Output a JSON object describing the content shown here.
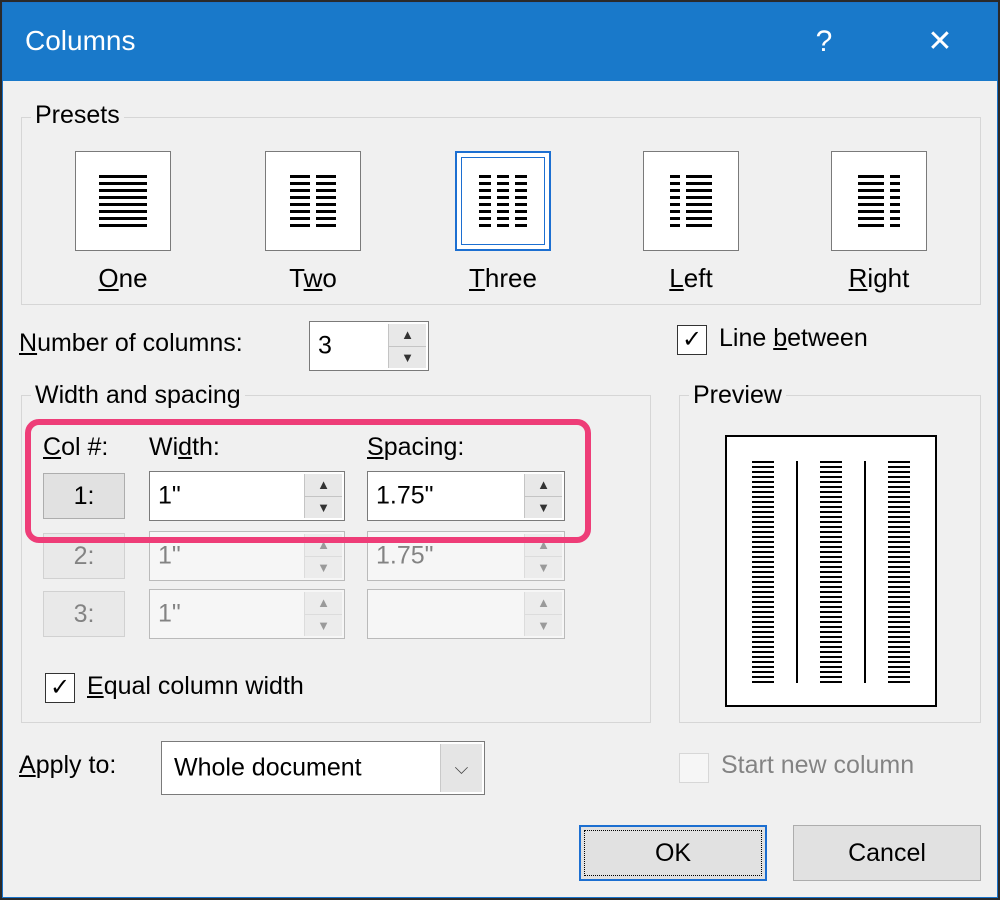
{
  "window": {
    "title": "Columns",
    "help_label": "?",
    "close_label": "✕"
  },
  "presets": {
    "group_label": "Presets",
    "items": [
      {
        "label": "One",
        "accel": "O",
        "rest": "ne"
      },
      {
        "label": "Two",
        "accel": "w",
        "before": "T",
        "rest": "o"
      },
      {
        "label": "Three",
        "accel": "T",
        "rest": "hree",
        "selected": true
      },
      {
        "label": "Left",
        "accel": "L",
        "rest": "eft"
      },
      {
        "label": "Right",
        "accel": "R",
        "rest": "ight"
      }
    ]
  },
  "number_of_columns": {
    "label_accel": "N",
    "label_rest": "umber of columns:",
    "value": "3"
  },
  "line_between": {
    "before": "Line ",
    "accel": "b",
    "rest": "etween",
    "checked": true,
    "check_glyph": "✓"
  },
  "width_spacing": {
    "group_label": "Width and spacing",
    "col_header_accel": "C",
    "col_header_rest": "ol #:",
    "width_header_before": "Wi",
    "width_header_accel": "d",
    "width_header_rest": "th:",
    "spacing_header_accel": "S",
    "spacing_header_rest": "pacing:",
    "rows": [
      {
        "col": "1:",
        "width": "1\"",
        "spacing": "1.75\"",
        "enabled": true
      },
      {
        "col": "2:",
        "width": "1\"",
        "spacing": "1.75\"",
        "enabled": false
      },
      {
        "col": "3:",
        "width": "1\"",
        "spacing": "",
        "enabled": false
      }
    ],
    "spin_up": "▲",
    "spin_down": "▼"
  },
  "equal_width": {
    "accel": "E",
    "rest": "qual column width",
    "checked": true,
    "check_glyph": "✓"
  },
  "preview": {
    "group_label": "Preview"
  },
  "apply_to": {
    "label_accel": "A",
    "label_rest": "pply to:",
    "value": "Whole document",
    "arrow": "⌵"
  },
  "start_new_column": {
    "label": "Start new column",
    "checked": false
  },
  "buttons": {
    "ok": "OK",
    "cancel": "Cancel"
  },
  "colors": {
    "titlebar": "#1979ca",
    "highlight": "#ee3d78",
    "focus": "#1c6fd1"
  }
}
